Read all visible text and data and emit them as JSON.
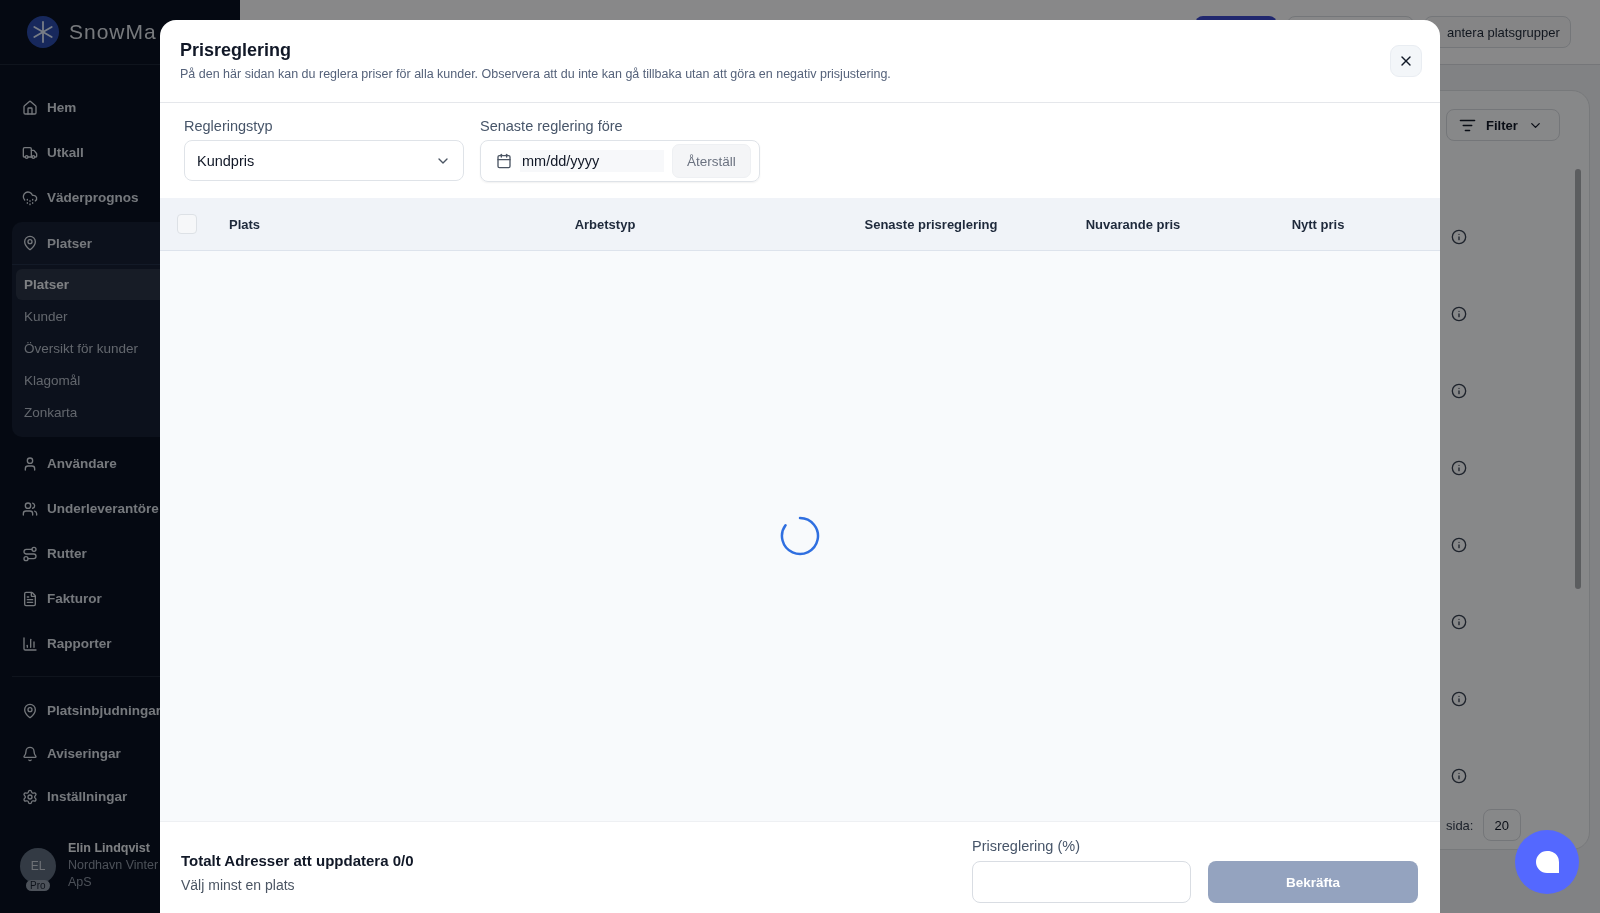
{
  "sidebar": {
    "brand": "SnowMa",
    "nav": [
      {
        "label": "Hem",
        "kind": "link"
      },
      {
        "label": "Utkall",
        "kind": "link"
      },
      {
        "label": "Väderprognos",
        "kind": "link"
      },
      {
        "label": "Platser",
        "kind": "group",
        "children": [
          {
            "label": "Platser",
            "selected": true
          },
          {
            "label": "Kunder",
            "selected": false
          },
          {
            "label": "Översikt för kunder",
            "selected": false
          },
          {
            "label": "Klagomål",
            "selected": false
          },
          {
            "label": "Zonkarta",
            "selected": false
          }
        ]
      },
      {
        "label": "Användare",
        "kind": "link"
      },
      {
        "label": "Underleverantöre",
        "kind": "link"
      },
      {
        "label": "Rutter",
        "kind": "link"
      },
      {
        "label": "Fakturor",
        "kind": "link"
      },
      {
        "label": "Rapporter",
        "kind": "link"
      }
    ],
    "secondary": [
      {
        "label": "Platsinbjudningar"
      },
      {
        "label": "Aviseringar"
      },
      {
        "label": "Inställningar"
      }
    ],
    "user": {
      "initials": "EL",
      "badge": "Pro",
      "name": "Elin Lindqvist",
      "org_line_1": "Nordhavn Vinter",
      "org_line_2": "ApS"
    }
  },
  "background": {
    "group_button": "antera platsgrupper",
    "filter_button": "Filter",
    "page_size_label": "sida:",
    "page_size": "20"
  },
  "dialog": {
    "title": "Prisreglering",
    "description": "På den här sidan kan du reglera priser för alla kunder. Observera att du inte kan gå tillbaka utan att göra en negativ prisjustering.",
    "adjustment_type": {
      "label": "Regleringstyp",
      "value": "Kundpris"
    },
    "date_filter": {
      "label": "Senaste reglering före",
      "placeholder": "mm/dd/yyyy",
      "reset_button": "Återställ"
    },
    "table": {
      "select_all_checked": false,
      "loading": true,
      "columns": [
        "Plats",
        "Arbetstyp",
        "Senaste prisreglering",
        "Nuvarande pris",
        "Nytt pris"
      ]
    },
    "footer": {
      "summary": "Totalt Adresser att uppdatera 0/0",
      "hint": "Välj minst en plats",
      "percent_label": "Prisreglering (%)",
      "confirm_button": "Bekräfta",
      "confirm_disabled": true
    }
  }
}
